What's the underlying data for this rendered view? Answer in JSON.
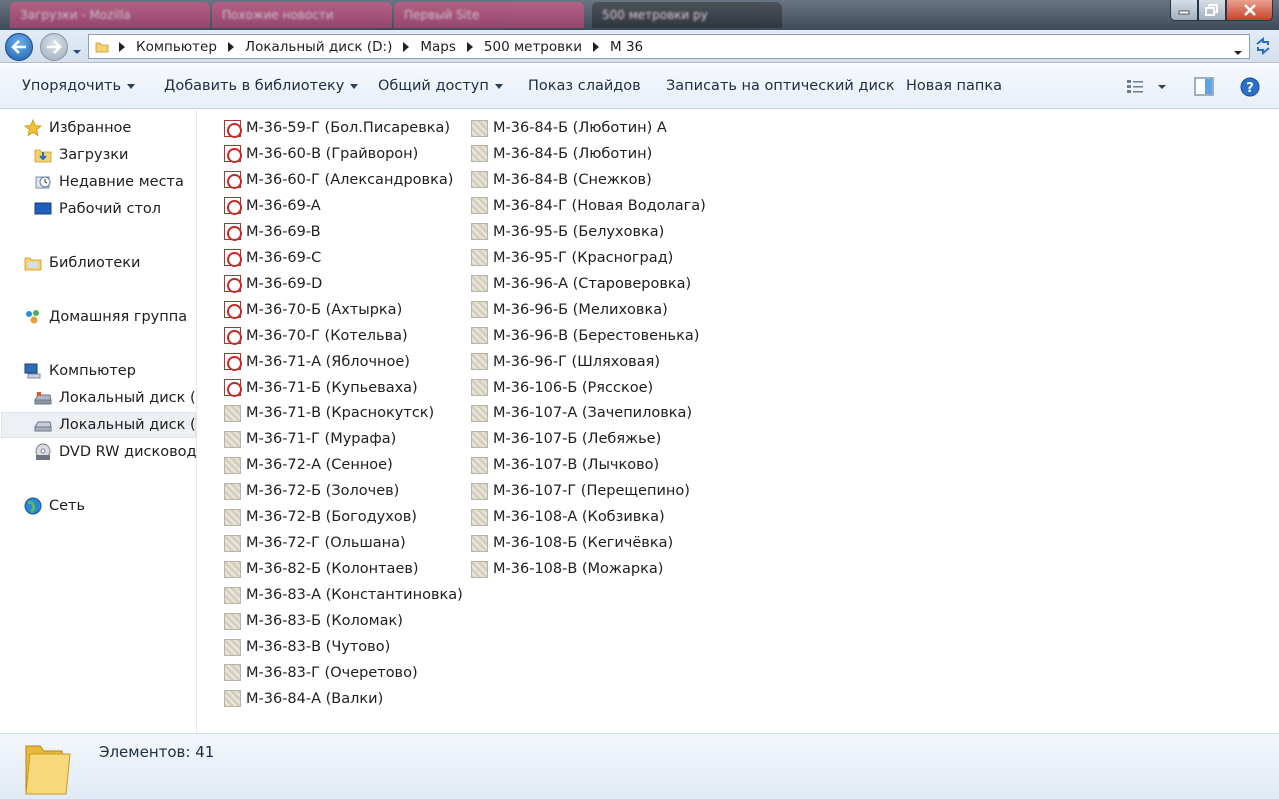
{
  "titlebar": {
    "background_tabs": [
      "Загрузки - Mozilla",
      "Похожие новости",
      "Первый Site",
      "500 метровки ру"
    ]
  },
  "address": {
    "crumbs": [
      "Компьютер",
      "Локальный диск (D:)",
      "Maps",
      "500 метровки",
      "M 36"
    ]
  },
  "toolbar": {
    "organize": "Упорядочить",
    "add_to_library": "Добавить в библиотеку",
    "share": "Общий доступ",
    "slideshow": "Показ слайдов",
    "burn": "Записать на оптический диск",
    "new_folder": "Новая папка"
  },
  "sidebar": {
    "favorites": "Избранное",
    "downloads": "Загрузки",
    "recent": "Недавние места",
    "desktop": "Рабочий стол",
    "libraries": "Библиотеки",
    "homegroup": "Домашняя группа",
    "computer": "Компьютер",
    "drive_c": "Локальный диск (C:)",
    "drive_d": "Локальный диск (D:)",
    "dvd": "DVD RW дисковод (",
    "network": "Сеть"
  },
  "files": [
    {
      "name": "M-36-59-Г (Бол.Писаревка)",
      "type": "pdf"
    },
    {
      "name": "M-36-60-В (Грайворон)",
      "type": "pdf"
    },
    {
      "name": "M-36-60-Г (Александровка)",
      "type": "pdf"
    },
    {
      "name": "M-36-69-A",
      "type": "pdf"
    },
    {
      "name": "M-36-69-B",
      "type": "pdf"
    },
    {
      "name": "M-36-69-C",
      "type": "pdf"
    },
    {
      "name": "M-36-69-D",
      "type": "pdf"
    },
    {
      "name": "M-36-70-Б (Ахтырка)",
      "type": "pdf"
    },
    {
      "name": "M-36-70-Г (Котельва)",
      "type": "pdf"
    },
    {
      "name": "M-36-71-А (Яблочное)",
      "type": "pdf"
    },
    {
      "name": "M-36-71-Б (Купьеваха)",
      "type": "pdf"
    },
    {
      "name": "M-36-71-В (Краснокутск)",
      "type": "img"
    },
    {
      "name": "M-36-71-Г (Мурафа)",
      "type": "img"
    },
    {
      "name": "M-36-72-А (Сенное)",
      "type": "img"
    },
    {
      "name": "M-36-72-Б (Золочев)",
      "type": "img"
    },
    {
      "name": "M-36-72-В (Богодухов)",
      "type": "img"
    },
    {
      "name": "M-36-72-Г (Ольшана)",
      "type": "img"
    },
    {
      "name": "M-36-82-Б (Колонтаев)",
      "type": "img"
    },
    {
      "name": "M-36-83-А (Константиновка)",
      "type": "img"
    },
    {
      "name": "M-36-83-Б (Коломак)",
      "type": "img"
    },
    {
      "name": "M-36-83-В (Чутово)",
      "type": "img"
    },
    {
      "name": "M-36-83-Г (Очеретово)",
      "type": "img"
    },
    {
      "name": "M-36-84-А (Валки)",
      "type": "img"
    },
    {
      "name": "M-36-84-Б (Люботин) А",
      "type": "img"
    },
    {
      "name": "M-36-84-Б (Люботин)",
      "type": "img"
    },
    {
      "name": "M-36-84-В (Снежков)",
      "type": "img"
    },
    {
      "name": "M-36-84-Г (Новая Водолага)",
      "type": "img"
    },
    {
      "name": "M-36-95-Б (Белуховка)",
      "type": "img"
    },
    {
      "name": "M-36-95-Г (Красноград)",
      "type": "img"
    },
    {
      "name": "M-36-96-А (Староверовка)",
      "type": "img"
    },
    {
      "name": "M-36-96-Б (Мелиховка)",
      "type": "img"
    },
    {
      "name": "M-36-96-В (Берестовенька)",
      "type": "img"
    },
    {
      "name": "M-36-96-Г (Шляховая)",
      "type": "img"
    },
    {
      "name": "M-36-106-Б (Рясское)",
      "type": "img"
    },
    {
      "name": "M-36-107-А (Зачепиловка)",
      "type": "img"
    },
    {
      "name": "M-36-107-Б (Лебяжье)",
      "type": "img"
    },
    {
      "name": "M-36-107-В (Лычково)",
      "type": "img"
    },
    {
      "name": "M-36-107-Г (Перещепино)",
      "type": "img"
    },
    {
      "name": "M-36-108-А (Кобзивка)",
      "type": "img"
    },
    {
      "name": "M-36-108-Б (Кегичёвка)",
      "type": "img"
    },
    {
      "name": "M-36-108-В (Можарка)",
      "type": "img"
    }
  ],
  "status": {
    "items_text": "Элементов: 41"
  }
}
